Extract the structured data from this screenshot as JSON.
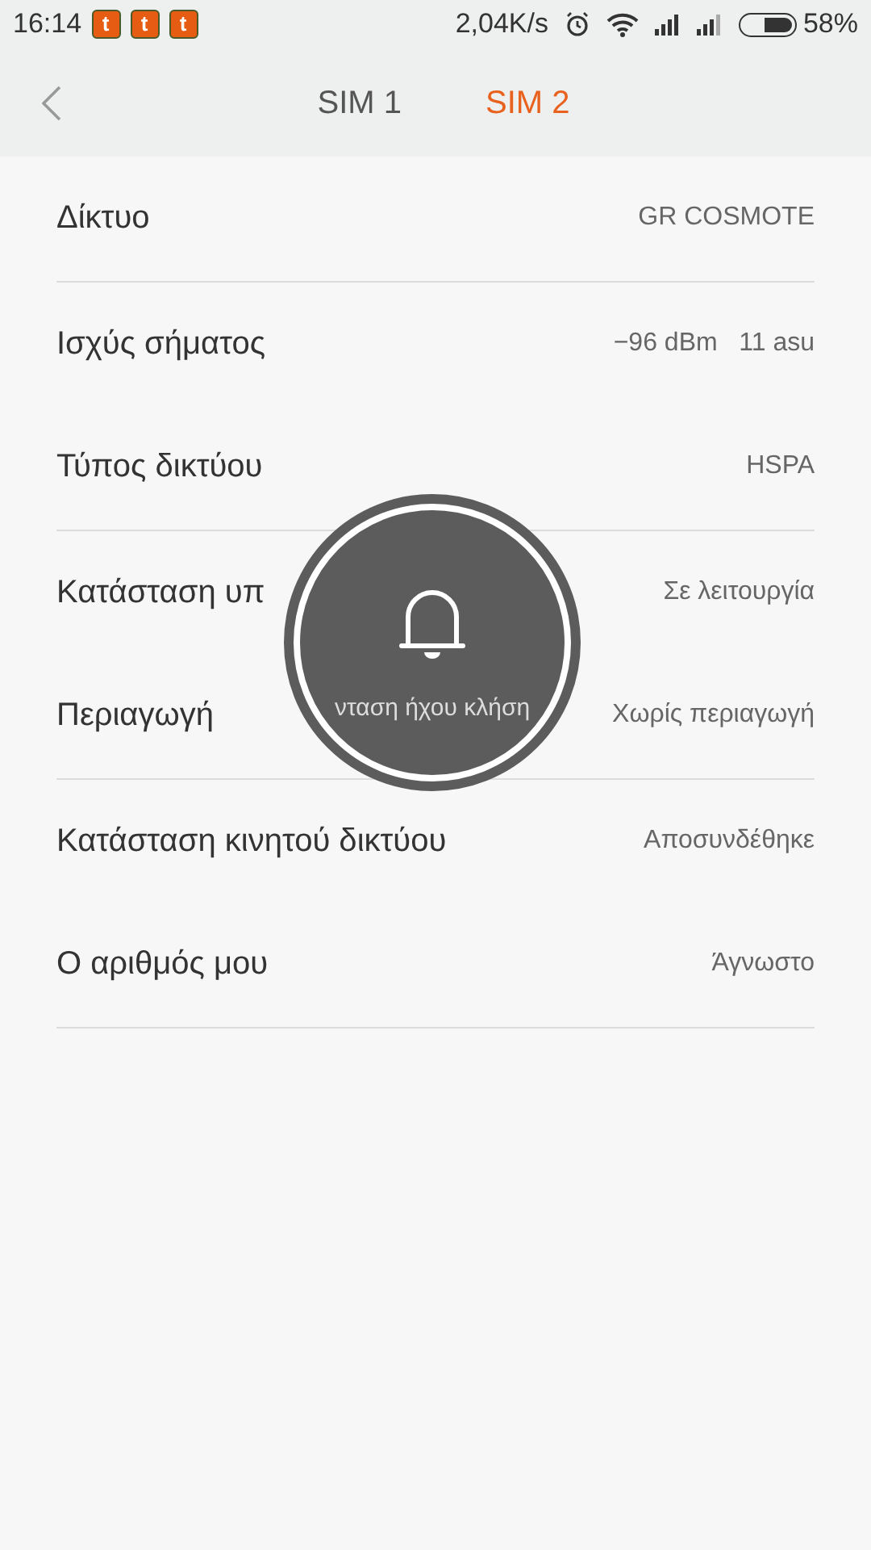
{
  "status_bar": {
    "time": "16:14",
    "notification_badges": [
      "t",
      "t",
      "t"
    ],
    "speed": "2,04K/s",
    "battery": "58%"
  },
  "header": {
    "tabs": [
      {
        "label": "SIM 1",
        "selected": false
      },
      {
        "label": "SIM 2",
        "selected": true
      }
    ]
  },
  "groups": [
    {
      "rows": [
        {
          "label": "Δίκτυο",
          "value": "GR COSMOTE"
        }
      ]
    },
    {
      "rows": [
        {
          "label": "Ισχύς σήματος",
          "value": "−96 dBm   11 asu"
        },
        {
          "label": "Τύπος δικτύου",
          "value": "HSPA"
        }
      ]
    },
    {
      "rows": [
        {
          "label": "Κατάσταση υπ",
          "value": "Σε λειτουργία"
        },
        {
          "label": "Περιαγωγή",
          "value": "Χωρίς περιαγωγή"
        }
      ]
    },
    {
      "rows": [
        {
          "label": "Κατάσταση κινητού δικτύου",
          "value": "Αποσυνδέθηκε"
        },
        {
          "label": "Ο αριθμός μου",
          "value": "Άγνωστο"
        }
      ]
    }
  ],
  "volume_overlay": {
    "label": "νταση ήχου κλήση"
  }
}
